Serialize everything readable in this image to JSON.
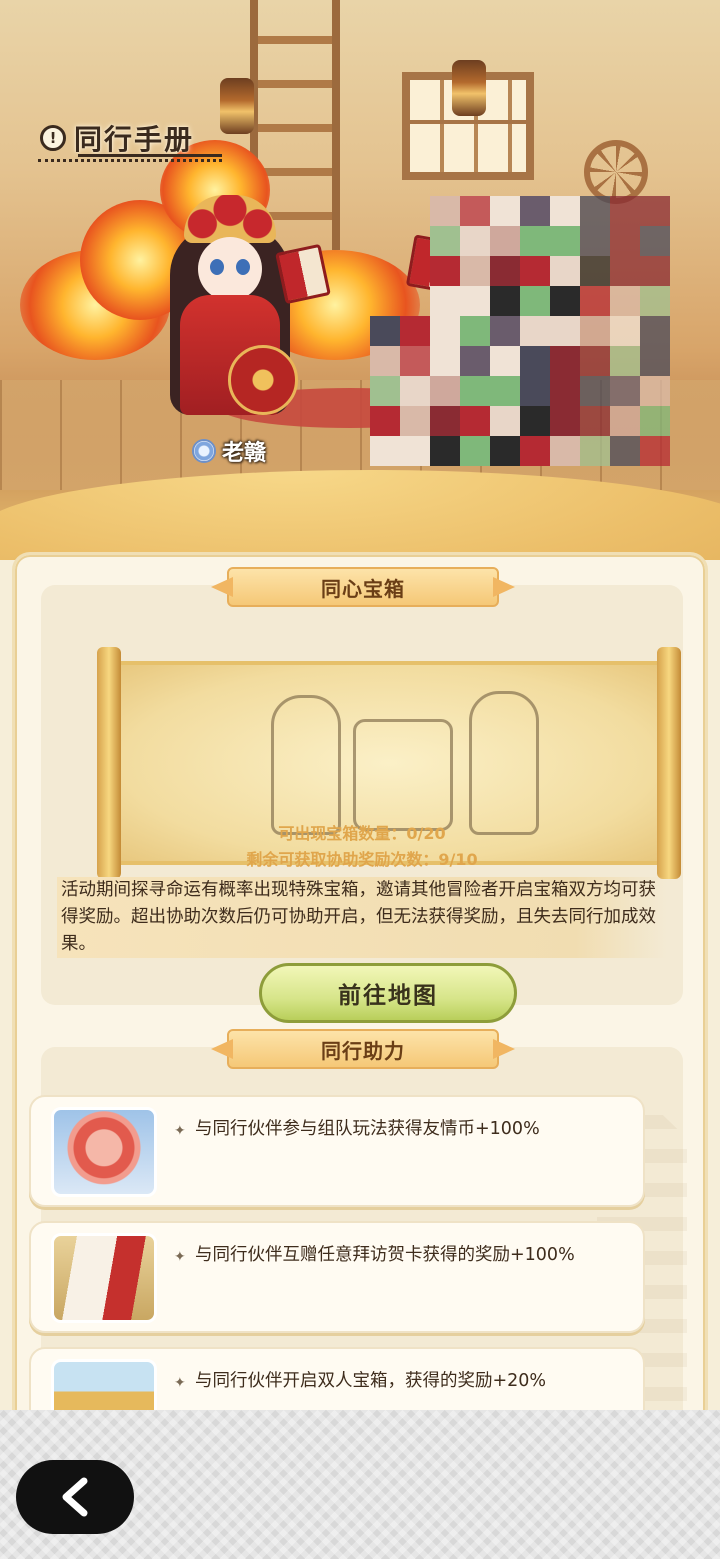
{
  "header": {
    "title": "同行手册",
    "info_icon_glyph": "!"
  },
  "scene": {
    "companion_name": "老赣",
    "companion_badge": "player-badge-icon"
  },
  "chest_section": {
    "title": "同心宝箱",
    "chest_count": "可出现宝箱数量：0/20",
    "assist_remaining": "剩余可获取协助奖励次数：9/10",
    "description": "活动期间探寻命运有概率出现特殊宝箱，邀请其他冒险者开启宝箱双方均可获得奖励。超出协助次数后仍可协助开启，但无法获得奖励，且失去同行加成效果。",
    "go_button_label": "前往地图"
  },
  "boost_section": {
    "title": "同行助力",
    "items": [
      {
        "icon": "friendship-coin-icon",
        "text": "与同行伙伴参与组队玩法获得友情币+100%"
      },
      {
        "icon": "greeting-card-icon",
        "text": "与同行伙伴互赠任意拜访贺卡获得的奖励+100%"
      },
      {
        "icon": "treasure-chest-icon",
        "text": "与同行伙伴开启双人宝箱，获得的奖励+20%"
      }
    ]
  },
  "nav": {
    "back_icon": "chevron-left-icon"
  },
  "colors": {
    "accent_text": "#e0a64c",
    "ribbon": "#f5c877",
    "go_button": "#d7e58a",
    "back_button": "#111111"
  }
}
